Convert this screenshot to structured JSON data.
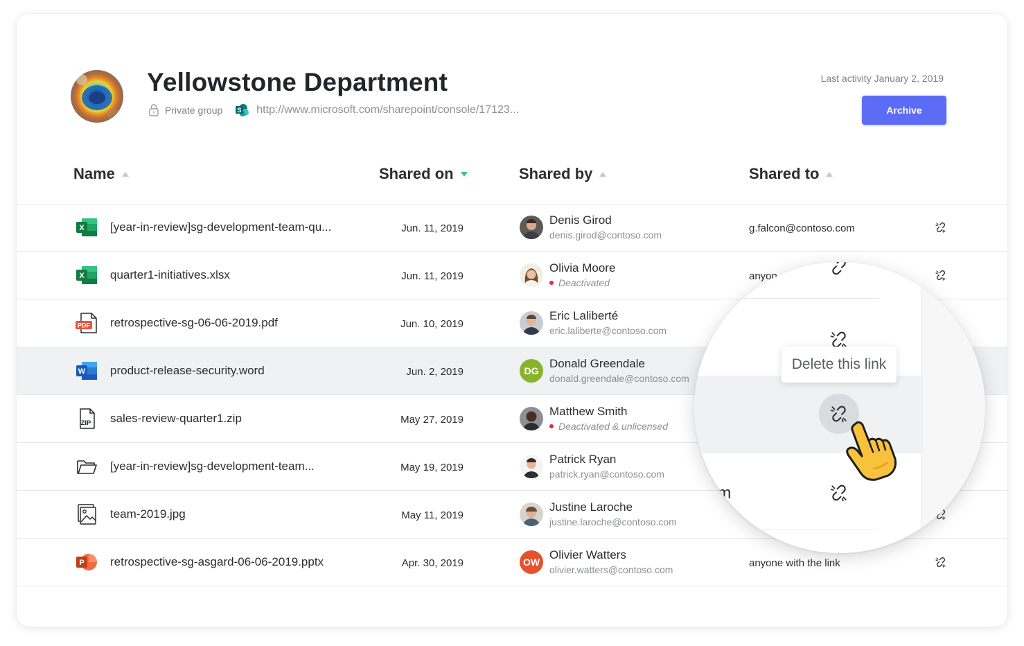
{
  "header": {
    "title": "Yellowstone Department",
    "privacy": "Private group",
    "url": "http://www.microsoft.com/sharepoint/console/17123...",
    "last_activity": "Last activity January 2, 2019",
    "archive_label": "Archive"
  },
  "columns": {
    "name": "Name",
    "shared_on": "Shared on",
    "shared_by": "Shared by",
    "shared_to": "Shared to"
  },
  "rows": [
    {
      "file": "[year-in-review]sg-development-team-qu...",
      "type": "excel",
      "date": "Jun. 11, 2019",
      "user": "Denis Girod",
      "sub": "denis.girod@contoso.com",
      "deactivated": false,
      "shared_to": "g.falcon@contoso.com"
    },
    {
      "file": "quarter1-initiatives.xlsx",
      "type": "excel",
      "date": "Jun. 11, 2019",
      "user": "Olivia Moore",
      "sub": "Deactivated",
      "deactivated": true,
      "shared_to": "anyon"
    },
    {
      "file": "retrospective-sg-06-06-2019.pdf",
      "type": "pdf",
      "date": "Jun. 10, 2019",
      "user": "Eric Laliberté",
      "sub": "eric.laliberte@contoso.com",
      "deactivated": false,
      "shared_to": ""
    },
    {
      "file": "product-release-security.word",
      "type": "word",
      "date": "Jun. 2, 2019",
      "user": "Donald Greendale",
      "sub": "donald.greendale@contoso.com",
      "deactivated": false,
      "shared_to": "",
      "initials": "DG"
    },
    {
      "file": "sales-review-quarter1.zip",
      "type": "zip",
      "date": "May 27, 2019",
      "user": "Matthew Smith",
      "sub": "Deactivated & unlicensed",
      "deactivated": true,
      "shared_to": ""
    },
    {
      "file": "[year-in-review]sg-development-team...",
      "type": "folder",
      "date": "May 19, 2019",
      "user": "Patrick Ryan",
      "sub": "patrick.ryan@contoso.com",
      "deactivated": false,
      "shared_to": ""
    },
    {
      "file": "team-2019.jpg",
      "type": "image",
      "date": "May 11, 2019",
      "user": "Justine Laroche",
      "sub": "justine.laroche@contoso.com",
      "deactivated": false,
      "shared_to": ""
    },
    {
      "file": "retrospective-sg-asgard-06-06-2019.pptx",
      "type": "powerpoint",
      "date": "Apr. 30, 2019",
      "user": "Olivier Watters",
      "sub": "olivier.watters@contoso.com",
      "deactivated": false,
      "shared_to": "anyone with the link",
      "initials": "OW"
    }
  ],
  "magnifier": {
    "tooltip": "Delete this link",
    "partial_text": "om"
  },
  "colors": {
    "accent": "#5d6cf5",
    "sort_active": "#2fc7a0",
    "deactivated_dot": "#e5293f",
    "initials_dg": "#8ab32d",
    "initials_ow": "#e5522e"
  }
}
